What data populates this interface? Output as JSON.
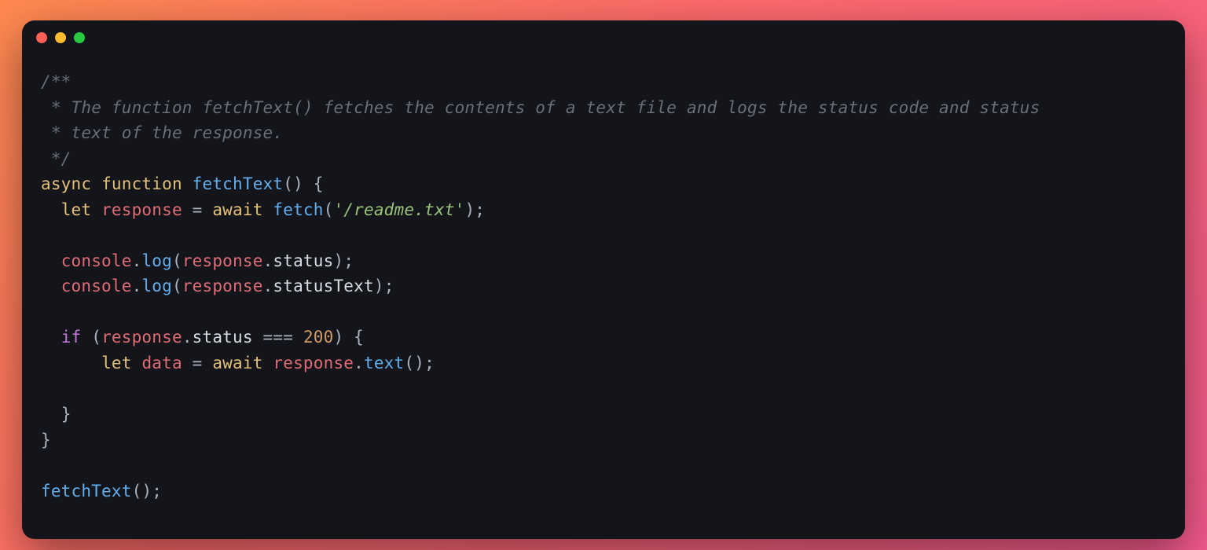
{
  "window": {
    "traffic_lights": [
      "red",
      "yellow",
      "green"
    ]
  },
  "code": {
    "comment_open": "/**",
    "comment_line1": " * The function fetchText() fetches the contents of a text file and logs the status code and status",
    "comment_line2": " * text of the response.",
    "comment_close": " */",
    "kw_async": "async",
    "kw_function": "function",
    "fn_name": "fetchText",
    "paren_open": "(",
    "paren_close": ")",
    "brace_open": "{",
    "brace_close": "}",
    "kw_let": "let",
    "id_response": "response",
    "op_assign": " = ",
    "kw_await": "await",
    "fn_fetch": "fetch",
    "str_readme": "'/readme.txt'",
    "semi": ";",
    "id_console": "console",
    "dot": ".",
    "fn_log": "log",
    "prop_status": "status",
    "prop_statusText": "statusText",
    "kw_if": "if",
    "op_eq": " === ",
    "num_200": "200",
    "id_data": "data",
    "fn_text": "text",
    "call_fetchText": "fetchText"
  }
}
